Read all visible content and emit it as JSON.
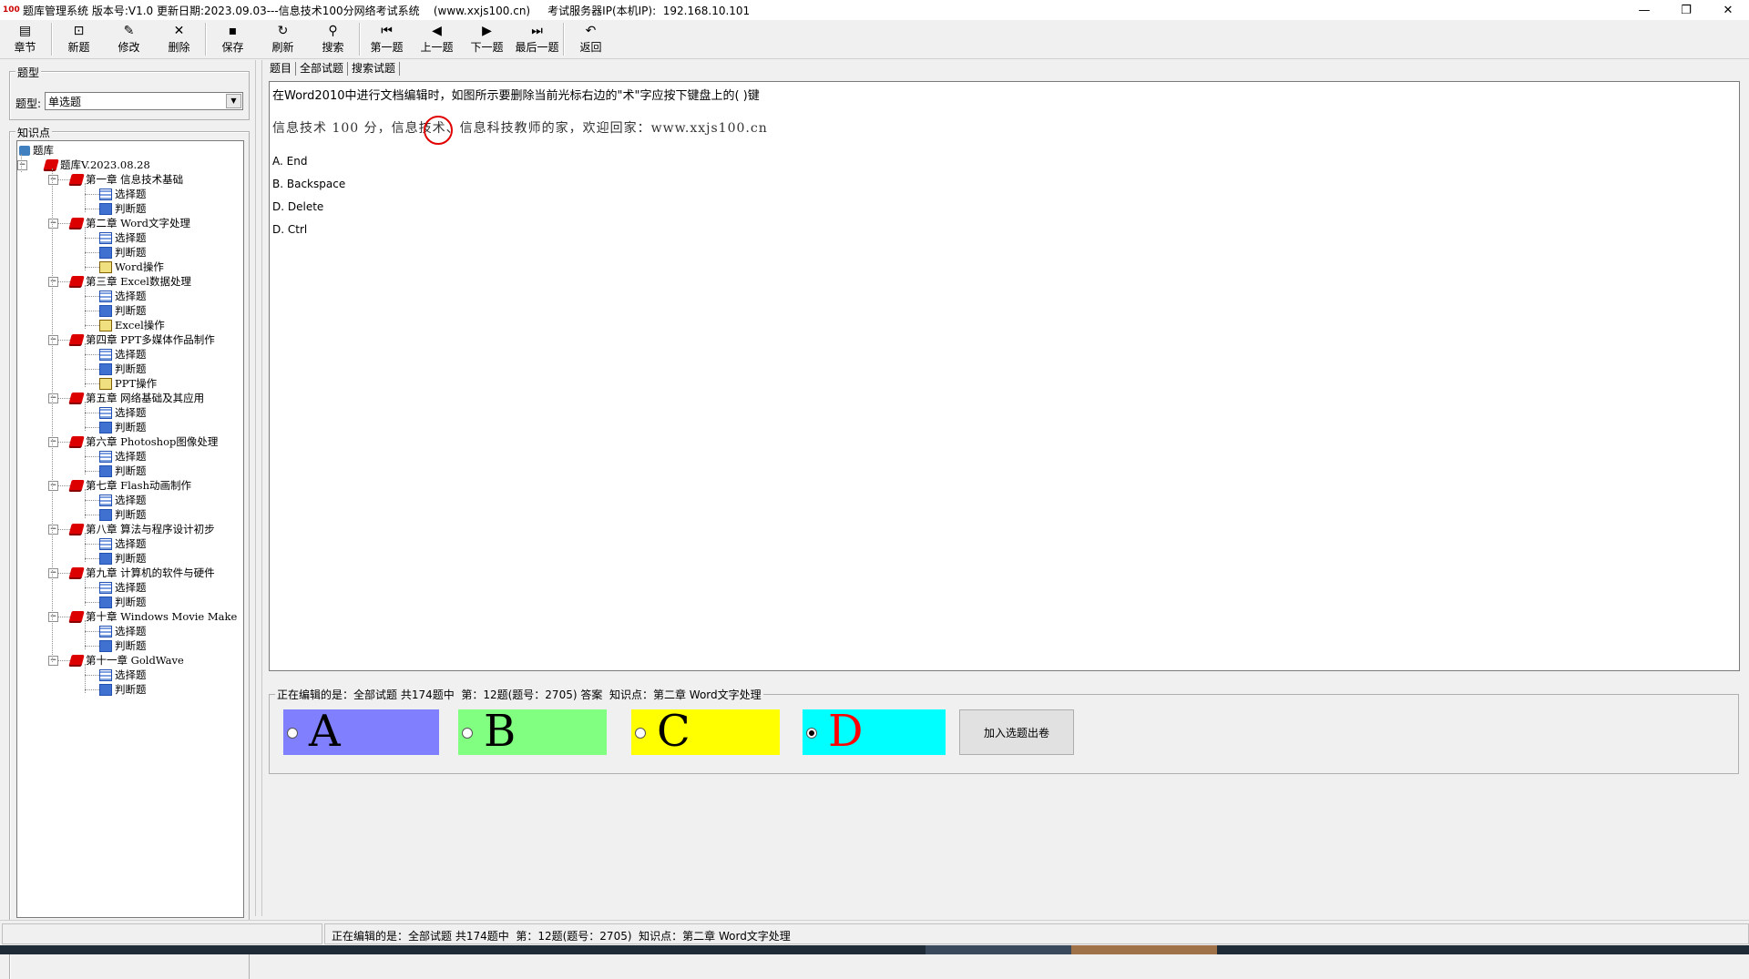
{
  "titlebar": {
    "title": "题库管理系统 版本号:V1.0 更新日期:2023.09.03---信息技术100分网络考试系统    (www.xxjs100.cn)     考试服务器IP(本机IP):  192.168.10.101",
    "minimize": "—",
    "restore": "❐",
    "close": "✕"
  },
  "toolbar": [
    {
      "label": "章节",
      "icon": "chapter-icon",
      "glyph": "▤"
    },
    {
      "label": "新题",
      "icon": "new-icon",
      "glyph": "⊡"
    },
    {
      "label": "修改",
      "icon": "edit-icon",
      "glyph": "✎"
    },
    {
      "label": "删除",
      "icon": "delete-icon",
      "glyph": "✕"
    },
    {
      "label": "保存",
      "icon": "save-icon",
      "glyph": "▪"
    },
    {
      "label": "刷新",
      "icon": "refresh-icon",
      "glyph": "↻"
    },
    {
      "label": "搜索",
      "icon": "search-icon",
      "glyph": "⚲"
    },
    {
      "label": "第一题",
      "icon": "first-icon",
      "glyph": "⏮"
    },
    {
      "label": "上一题",
      "icon": "prev-icon",
      "glyph": "◀"
    },
    {
      "label": "下一题",
      "icon": "next-icon",
      "glyph": "▶"
    },
    {
      "label": "最后一题",
      "icon": "last-icon",
      "glyph": "⏭"
    },
    {
      "label": "返回",
      "icon": "back-icon",
      "glyph": "↶"
    }
  ],
  "left": {
    "type_group_label": "题型",
    "type_label": "题型:",
    "type_value": "单选题",
    "knowledge_group_label": "知识点"
  },
  "tree": {
    "root": "题库",
    "bank": "题库V.2023.08.28",
    "chapters": [
      {
        "name": "第一章 信息技术基础",
        "children": [
          "选择题",
          "判断题"
        ]
      },
      {
        "name": "第二章 Word文字处理",
        "children": [
          "选择题",
          "判断题",
          "Word操作"
        ]
      },
      {
        "name": "第三章 Excel数据处理",
        "children": [
          "选择题",
          "判断题",
          "Excel操作"
        ]
      },
      {
        "name": "第四章 PPT多媒体作品制作",
        "children": [
          "选择题",
          "判断题",
          "PPT操作"
        ]
      },
      {
        "name": "第五章 网络基础及其应用",
        "children": [
          "选择题",
          "判断题"
        ]
      },
      {
        "name": "第六章 Photoshop图像处理",
        "children": [
          "选择题",
          "判断题"
        ]
      },
      {
        "name": "第七章 Flash动画制作",
        "children": [
          "选择题",
          "判断题"
        ]
      },
      {
        "name": "第八章 算法与程序设计初步",
        "children": [
          "选择题",
          "判断题"
        ]
      },
      {
        "name": "第九章 计算机的软件与硬件",
        "children": [
          "选择题",
          "判断题"
        ]
      },
      {
        "name": "第十章 Windows Movie Make",
        "children": [
          "选择题",
          "判断题"
        ]
      },
      {
        "name": "第十一章 GoldWave",
        "children": [
          "选择题",
          "判断题"
        ]
      }
    ]
  },
  "tabs": [
    "题目",
    "全部试题",
    "搜索试题"
  ],
  "question": {
    "text": "在Word2010中进行文档编辑时，如图所示要删除当前光标右边的\"术\"字应按下键盘上的( )键",
    "image_text": "信息技术 100 分，信息技术、信息科技教师的家，欢迎回家：www.xxjs100.cn",
    "options": [
      "A. End",
      "B. Backspace",
      "D. Delete",
      "D. Ctrl"
    ]
  },
  "answer": {
    "legend": "正在编辑的是：全部试题 共174题中  第：12题(题号：2705) 答案  知识点：第二章 Word文字处理",
    "choices": [
      {
        "letter": "A",
        "bg": "#8080ff",
        "color": "#000000",
        "selected": false
      },
      {
        "letter": "B",
        "bg": "#80ff80",
        "color": "#000000",
        "selected": false
      },
      {
        "letter": "C",
        "bg": "#ffff00",
        "color": "#000000",
        "selected": false
      },
      {
        "letter": "D",
        "bg": "#00ffff",
        "color": "#ff0000",
        "selected": true
      }
    ],
    "add_button": "加入选题出卷"
  },
  "status": {
    "text": "正在编辑的是：全部试题 共174题中  第：12题(题号：2705)  知识点：第二章 Word文字处理"
  }
}
